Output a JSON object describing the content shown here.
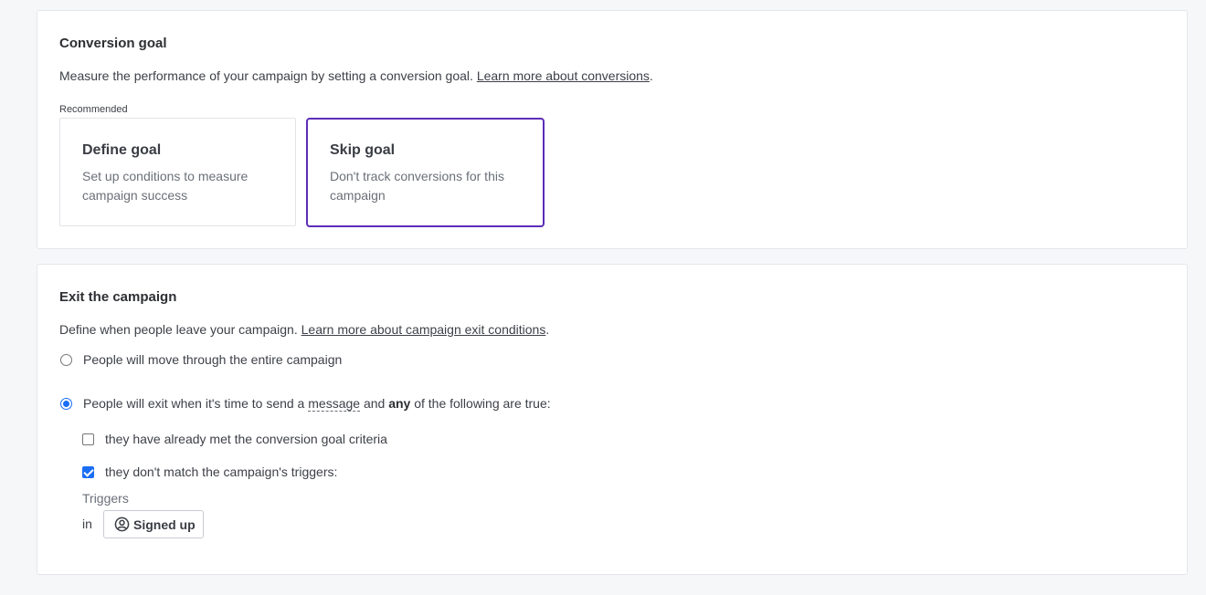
{
  "conversion": {
    "title": "Conversion goal",
    "description": "Measure the performance of your campaign by setting a conversion goal. ",
    "link": "Learn more about conversions",
    "after_link": ".",
    "recommended_label": "Recommended",
    "cards": [
      {
        "title": "Define goal",
        "description": "Set up conditions to measure campaign success",
        "selected": false
      },
      {
        "title": "Skip goal",
        "description": "Don't track conversions for this campaign",
        "selected": true
      }
    ],
    "accent_color": "#5c2cb8"
  },
  "exit": {
    "title": "Exit the campaign",
    "description": "Define when people leave your campaign. ",
    "link": "Learn more about campaign exit conditions",
    "after_link": ".",
    "option_1": "People will move through the entire campaign",
    "option_2_pre": "People will exit when it's time to send a ",
    "option_2_message": "message",
    "option_2_mid": " and ",
    "option_2_any": "any",
    "option_2_post": " of the following are true:",
    "selected_option": 2,
    "checks": [
      {
        "label": "they have already met the conversion goal criteria",
        "checked": false
      },
      {
        "label": "they don't match the campaign's triggers:",
        "checked": true
      }
    ],
    "triggers_label": "Triggers",
    "in_label": "in",
    "trigger_chip": {
      "label": "Signed up",
      "icon": "user-circle-icon"
    }
  }
}
